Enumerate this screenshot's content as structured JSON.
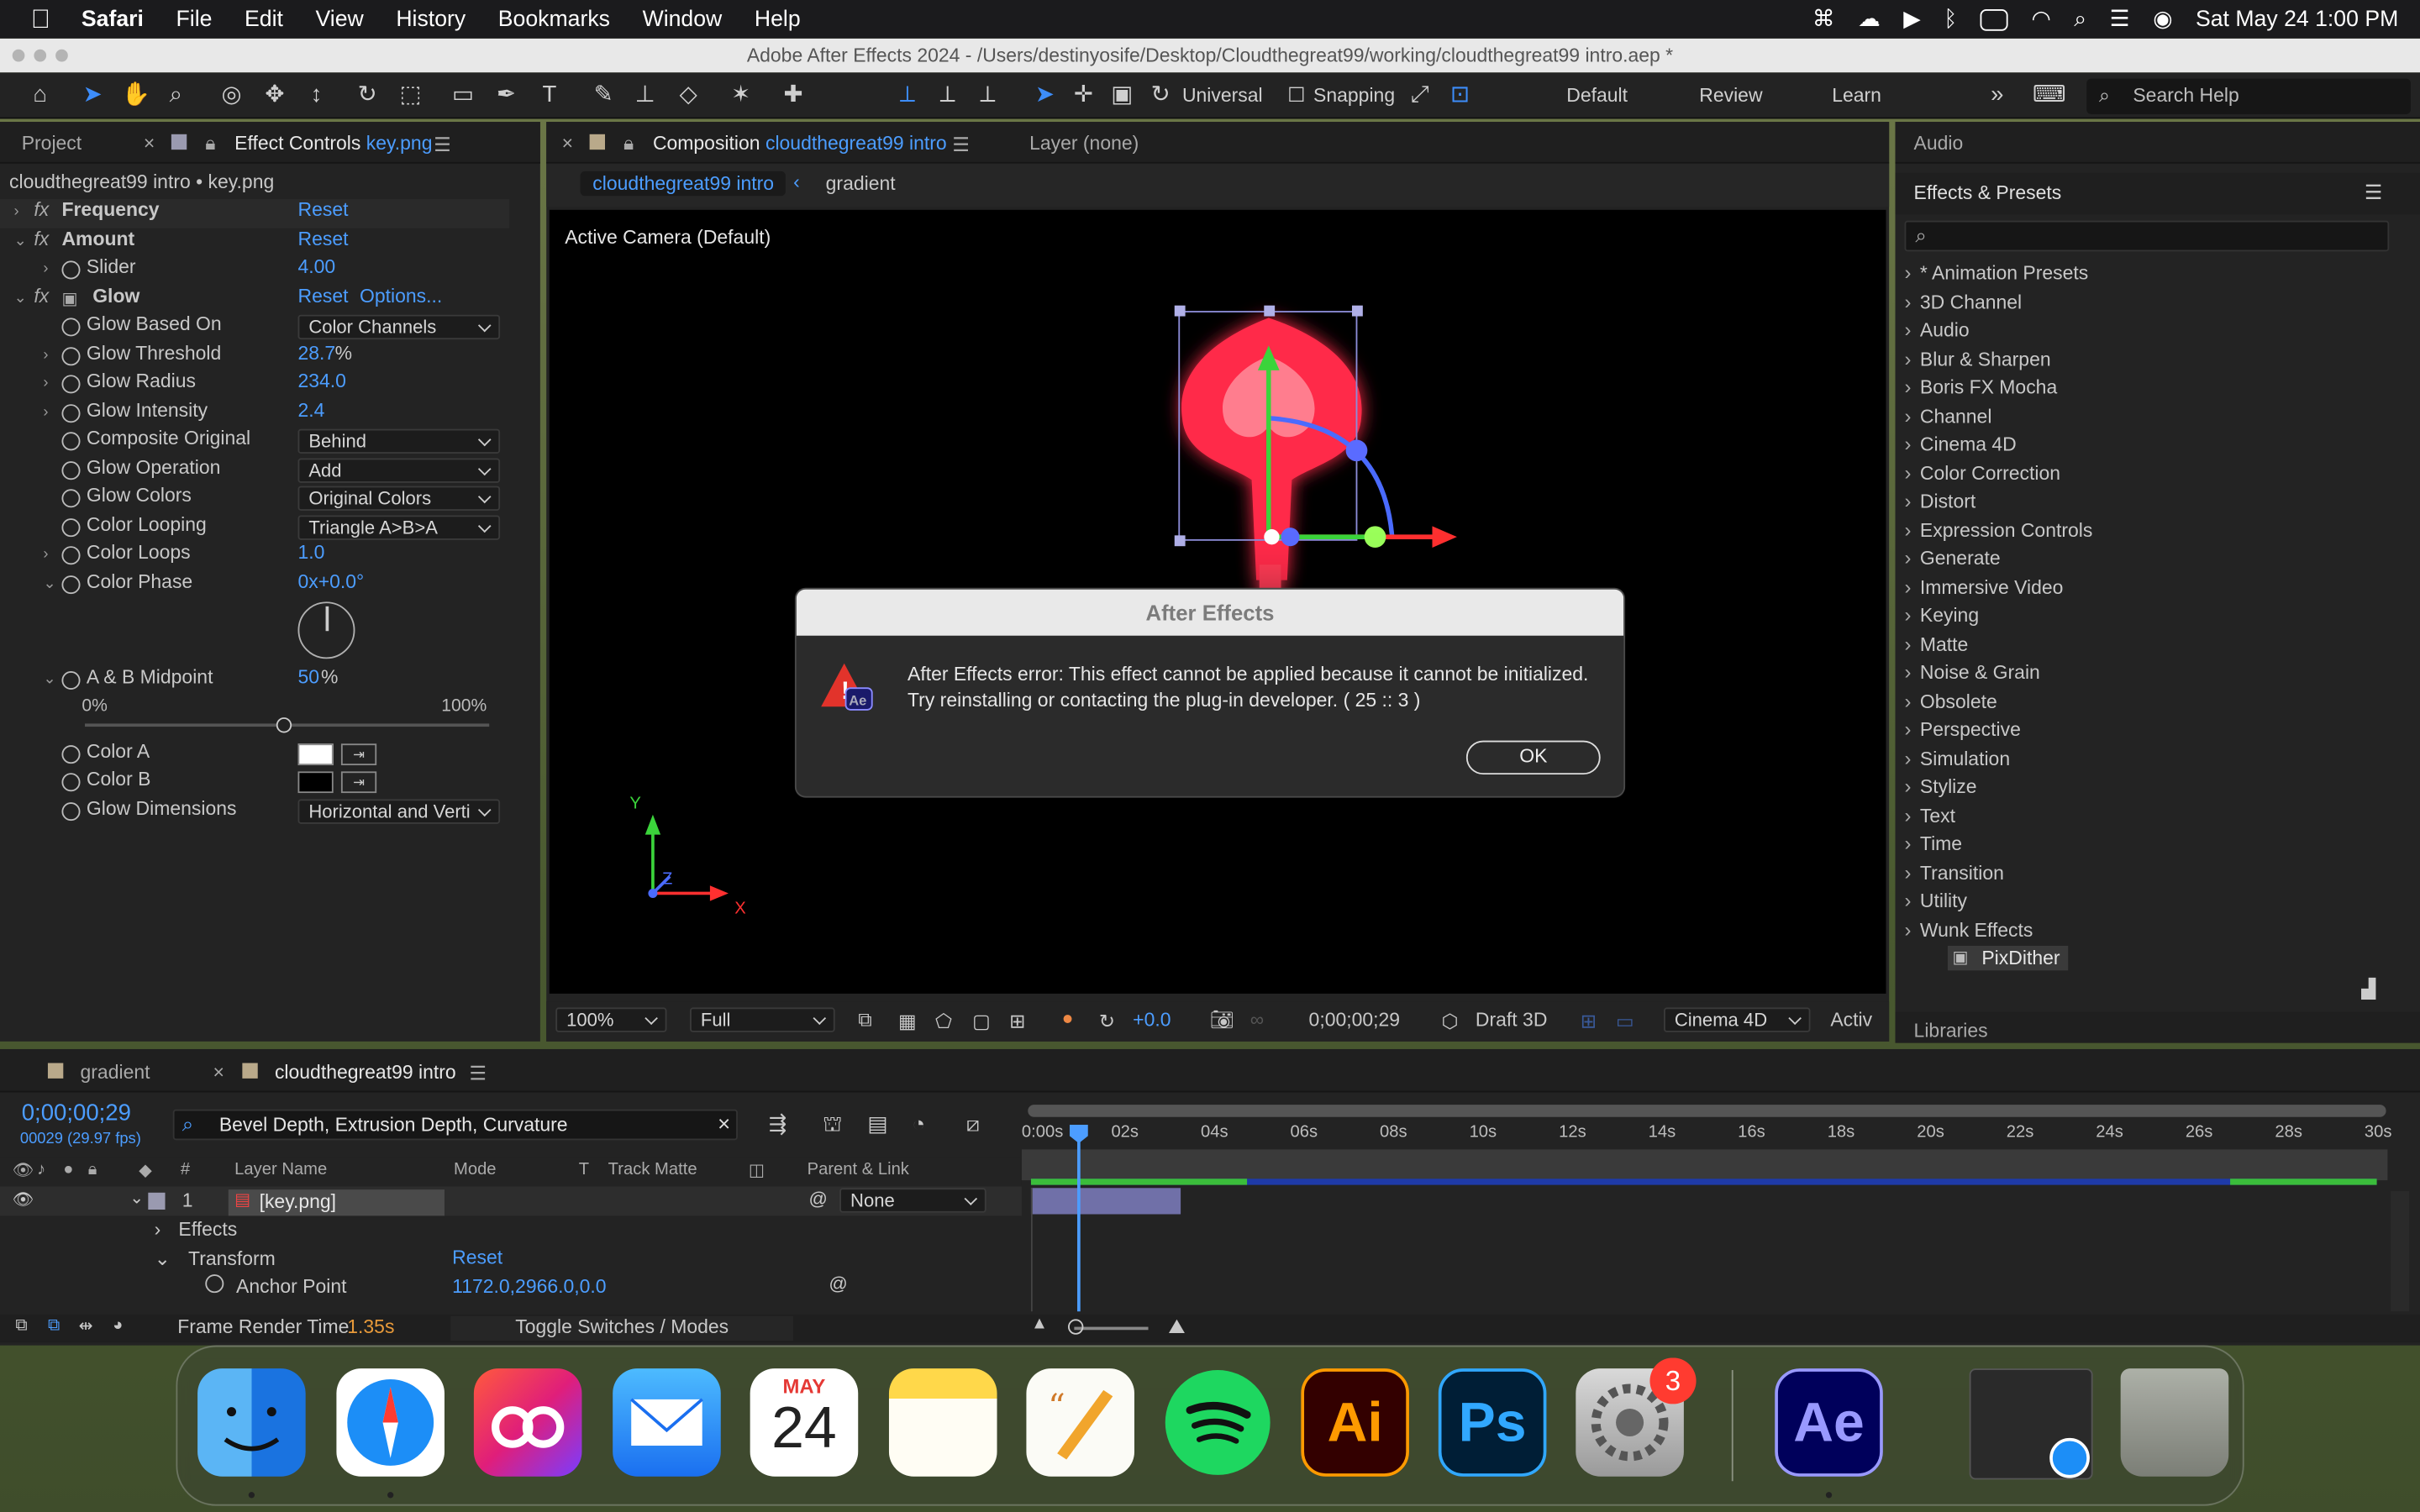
{
  "menubar": {
    "app": "Safari",
    "items": [
      "File",
      "Edit",
      "View",
      "History",
      "Bookmarks",
      "Window",
      "Help"
    ],
    "datetime": "Sat May 24  1:00 PM"
  },
  "window": {
    "title": "Adobe After Effects 2024 - /Users/destinyosife/Desktop/Cloudthegreat99/working/cloudthegreat99 intro.aep *"
  },
  "toolbar": {
    "universal": "Universal",
    "snapping": "Snapping",
    "workspaces": [
      "Default",
      "Review",
      "Learn"
    ],
    "search_placeholder": "Search Help"
  },
  "effect_panel": {
    "tab_project": "Project",
    "tab_effect": "Effect Controls",
    "tab_effect_file": "key.png",
    "breadcrumb": "cloudthegreat99 intro • key.png",
    "rows": [
      {
        "label": "Frequency",
        "value": "Reset"
      },
      {
        "label": "Amount",
        "value": "Reset"
      },
      {
        "label": "Slider",
        "value": "4.00"
      },
      {
        "label": "Glow",
        "value": "Reset",
        "extra": "Options..."
      },
      {
        "label": "Glow Based On",
        "value": "Color Channels"
      },
      {
        "label": "Glow Threshold",
        "value": "28.7",
        "unit": "%"
      },
      {
        "label": "Glow Radius",
        "value": "234.0"
      },
      {
        "label": "Glow Intensity",
        "value": "2.4"
      },
      {
        "label": "Composite Original",
        "value": "Behind"
      },
      {
        "label": "Glow Operation",
        "value": "Add"
      },
      {
        "label": "Glow Colors",
        "value": "Original Colors"
      },
      {
        "label": "Color Looping",
        "value": "Triangle A>B>A"
      },
      {
        "label": "Color Loops",
        "value": "1.0"
      },
      {
        "label": "Color Phase",
        "value": "0x+0.0°"
      },
      {
        "label": "A & B Midpoint",
        "value": "50",
        "unit": "%"
      },
      {
        "label": "Color A",
        "value": ""
      },
      {
        "label": "Color B",
        "value": ""
      },
      {
        "label": "Glow Dimensions",
        "value": "Horizontal and Verti"
      }
    ],
    "slider_min": "0%",
    "slider_max": "100%"
  },
  "composition": {
    "tab_label": "Composition",
    "comp_name": "cloudthegreat99 intro",
    "layer_tab": "Layer (none)",
    "sub_tabs": [
      "cloudthegreat99 intro",
      "gradient"
    ],
    "camera": "Active Camera (Default)",
    "axis_x": "X",
    "axis_y": "Y",
    "axis_z": "Z",
    "footer": {
      "zoom": "100%",
      "resolution": "Full",
      "exposure": "+0.0",
      "timecode": "0;00;00;29",
      "draft": "Draft 3D",
      "renderer": "Cinema 4D",
      "active": "Activ"
    }
  },
  "dialog": {
    "title": "After Effects",
    "message": "After Effects error: This effect cannot be applied because it cannot be initialized. Try reinstalling or contacting the plug-in developer. ( 25 :: 3 )",
    "ok": "OK"
  },
  "right_panel": {
    "audio": "Audio",
    "effects_title": "Effects & Presets",
    "categories": [
      "* Animation Presets",
      "3D Channel",
      "Audio",
      "Blur & Sharpen",
      "Boris FX Mocha",
      "Channel",
      "Cinema 4D",
      "Color Correction",
      "Distort",
      "Expression Controls",
      "Generate",
      "Immersive Video",
      "Keying",
      "Matte",
      "Noise & Grain",
      "Obsolete",
      "Perspective",
      "Simulation",
      "Stylize",
      "Text",
      "Time",
      "Transition",
      "Utility",
      "Wunk Effects"
    ],
    "selected_effect": "PixDither",
    "libraries": "Libraries"
  },
  "timeline": {
    "tab_gradient": "gradient",
    "tab_comp": "cloudthegreat99 intro",
    "timecode": "0;00;00;29",
    "fps": "00029 (29.97 fps)",
    "search": "Bevel Depth, Extrusion Depth, Curvature",
    "columns": {
      "num": "#",
      "layer_name": "Layer Name",
      "mode": "Mode",
      "t": "T",
      "track_matte": "Track Matte",
      "parent": "Parent & Link"
    },
    "layer": {
      "num": "1",
      "name": "[key.png]",
      "parent": "None"
    },
    "effects": "Effects",
    "transform": "Transform",
    "transform_reset": "Reset",
    "anchor_label": "Anchor Point",
    "anchor_value": "1172.0,2966.0,0.0",
    "ruler": [
      "0:00s",
      "02s",
      "04s",
      "06s",
      "08s",
      "10s",
      "12s",
      "14s",
      "16s",
      "18s",
      "20s",
      "22s",
      "24s",
      "26s",
      "28s",
      "30s"
    ],
    "frame_render": "Frame Render Time",
    "frame_render_value": "1.35s",
    "toggle": "Toggle Switches / Modes"
  },
  "dock": {
    "calendar_month": "MAY",
    "calendar_day": "24",
    "ai": "Ai",
    "ps": "Ps",
    "ae": "Ae",
    "settings_badge": "3"
  }
}
